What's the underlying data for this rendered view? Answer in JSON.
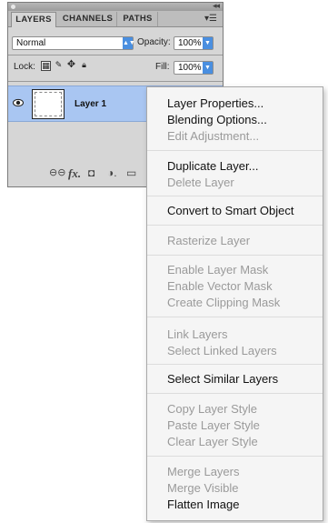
{
  "panel": {
    "tabs": [
      {
        "label": "LAYERS",
        "active": true
      },
      {
        "label": "CHANNELS",
        "active": false
      },
      {
        "label": "PATHS",
        "active": false
      }
    ],
    "blend_mode": "Normal",
    "opacity_label": "Opacity:",
    "opacity_value": "100%",
    "lock_label": "Lock:",
    "fill_label": "Fill:",
    "fill_value": "100%",
    "layer": {
      "name": "Layer 1"
    },
    "footer_icons": [
      "link-icon",
      "fx-icon",
      "mask-icon",
      "adjustment-icon",
      "group-icon"
    ],
    "fx_label": "fx."
  },
  "context_menu": {
    "groups": [
      {
        "items": [
          {
            "label": "Layer Properties...",
            "enabled": true
          },
          {
            "label": "Blending Options...",
            "enabled": true
          },
          {
            "label": "Edit Adjustment...",
            "enabled": false
          }
        ]
      },
      {
        "items": [
          {
            "label": "Duplicate Layer...",
            "enabled": true
          },
          {
            "label": "Delete Layer",
            "enabled": false
          }
        ]
      },
      {
        "items": [
          {
            "label": "Convert to Smart Object",
            "enabled": true
          }
        ]
      },
      {
        "items": [
          {
            "label": "Rasterize Layer",
            "enabled": false
          }
        ]
      },
      {
        "items": [
          {
            "label": "Enable Layer Mask",
            "enabled": false
          },
          {
            "label": "Enable Vector Mask",
            "enabled": false
          },
          {
            "label": "Create Clipping Mask",
            "enabled": false
          }
        ]
      },
      {
        "items": [
          {
            "label": "Link Layers",
            "enabled": false
          },
          {
            "label": "Select Linked Layers",
            "enabled": false
          }
        ]
      },
      {
        "items": [
          {
            "label": "Select Similar Layers",
            "enabled": true
          }
        ]
      },
      {
        "items": [
          {
            "label": "Copy Layer Style",
            "enabled": false
          },
          {
            "label": "Paste Layer Style",
            "enabled": false
          },
          {
            "label": "Clear Layer Style",
            "enabled": false
          }
        ]
      },
      {
        "items": [
          {
            "label": "Merge Layers",
            "enabled": false
          },
          {
            "label": "Merge Visible",
            "enabled": false
          },
          {
            "label": "Flatten Image",
            "enabled": true
          }
        ]
      }
    ]
  },
  "colors": {
    "selected_layer": "#a9c6f2",
    "menu_enabled_text": "#111111",
    "menu_disabled_text": "#9a9a9a",
    "select_arrow": "#4a8fe0"
  }
}
